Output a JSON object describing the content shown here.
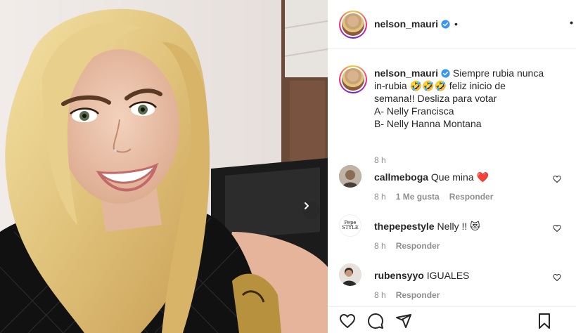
{
  "post": {
    "username": "nelson_mauri",
    "header_separator": "•",
    "more_label": "•",
    "caption_line1": "Siempre rubia nunca",
    "caption_line2_prefix": "in-rubia",
    "caption_emoji": "🤣🤣🤣",
    "caption_line2_suffix": " feliz inicio de",
    "caption_line3": "semana!! Desliza para votar",
    "caption_line4": "A- Nelly Francisca",
    "caption_line5": "B- Nelly Hanna Montana",
    "time": "8 h"
  },
  "comments": [
    {
      "username": "callmeboga",
      "text": "Que mina",
      "emoji": "❤️",
      "time": "8 h",
      "likes": "1 Me gusta",
      "reply": "Responder",
      "avatar_color": "#7a6a5a"
    },
    {
      "username": "thepepestyle",
      "text": "Nelly !!",
      "emoji": "😻",
      "time": "8 h",
      "likes": "",
      "reply": "Responder",
      "avatar_color": "#ffffff"
    },
    {
      "username": "rubensyyo",
      "text": "IGUALES",
      "emoji": "",
      "time": "8 h",
      "likes": "",
      "reply": "Responder",
      "avatar_color": "#d8d0c8"
    }
  ],
  "avatar_text": "Pepe STYLE",
  "colors": {
    "verified": "#3897f0",
    "heart_red": "#ed4956",
    "muted": "#8e8e8e"
  }
}
